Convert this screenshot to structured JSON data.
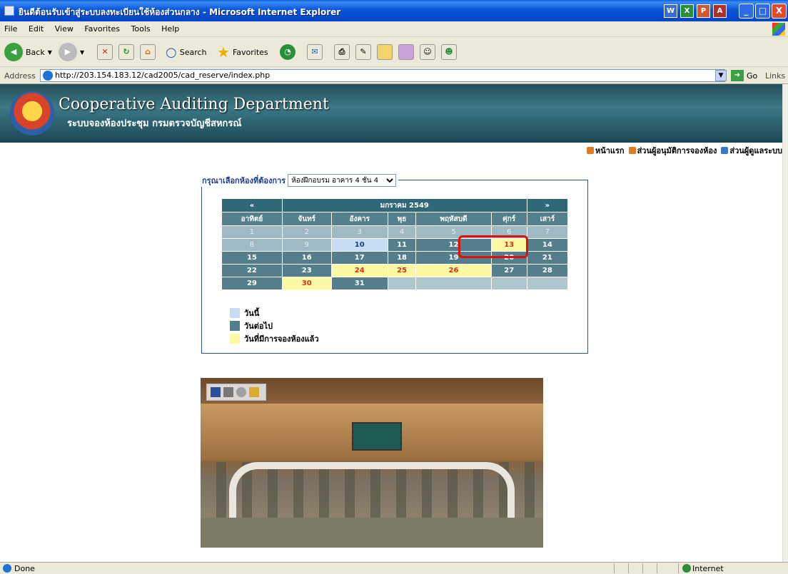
{
  "window": {
    "title": "ยินดีต้อนรับเข้าสู่ระบบลงทะเบียนใช้ห้องส่วนกลาง - Microsoft Internet Explorer",
    "taskbar_apps": [
      "W",
      "X",
      "P",
      "A"
    ],
    "controls": {
      "minimize": "_",
      "maximize": "□",
      "close": "X"
    }
  },
  "menu": [
    "File",
    "Edit",
    "View",
    "Favorites",
    "Tools",
    "Help"
  ],
  "toolbar": {
    "back": "Back",
    "search": "Search",
    "favorites": "Favorites"
  },
  "address": {
    "label": "Address",
    "url": "http://203.154.183.12/cad2005/cad_reserve/index.php",
    "go": "Go",
    "links": "Links"
  },
  "banner": {
    "title": "Cooperative Auditing Department",
    "subtitle": "ระบบจองห้องประชุม กรมตรวจบัญชีสหกรณ์"
  },
  "topnav": [
    "หน้าแรก",
    "ส่วนผู้อนุมัติการจองห้อง",
    "ส่วนผู้ดูแลระบบ"
  ],
  "room_select": {
    "label": "กรุณาเลือกห้องที่ต้องการ",
    "selected": "ห้องฝึกอบรม อาคาร 4 ชั้น 4"
  },
  "calendar": {
    "prev": "«",
    "next": "»",
    "month": "มกราคม 2549",
    "days_of_week": [
      "อาทิตย์",
      "จันทร์",
      "อังคาร",
      "พุธ",
      "พฤหัสบดี",
      "ศุกร์",
      "เสาร์"
    ],
    "weeks": [
      [
        {
          "d": "1",
          "s": "past"
        },
        {
          "d": "2",
          "s": "past"
        },
        {
          "d": "3",
          "s": "past"
        },
        {
          "d": "4",
          "s": "past"
        },
        {
          "d": "5",
          "s": "past"
        },
        {
          "d": "6",
          "s": "past"
        },
        {
          "d": "7",
          "s": "past"
        }
      ],
      [
        {
          "d": "8",
          "s": "past"
        },
        {
          "d": "9",
          "s": "past"
        },
        {
          "d": "10",
          "s": "today"
        },
        {
          "d": "11",
          "s": "next"
        },
        {
          "d": "12",
          "s": "next"
        },
        {
          "d": "13",
          "s": "booked"
        },
        {
          "d": "14",
          "s": "next"
        }
      ],
      [
        {
          "d": "15",
          "s": "next"
        },
        {
          "d": "16",
          "s": "next"
        },
        {
          "d": "17",
          "s": "next"
        },
        {
          "d": "18",
          "s": "next"
        },
        {
          "d": "19",
          "s": "next"
        },
        {
          "d": "20",
          "s": "next"
        },
        {
          "d": "21",
          "s": "next"
        }
      ],
      [
        {
          "d": "22",
          "s": "next"
        },
        {
          "d": "23",
          "s": "next"
        },
        {
          "d": "24",
          "s": "booked"
        },
        {
          "d": "25",
          "s": "booked"
        },
        {
          "d": "26",
          "s": "booked"
        },
        {
          "d": "27",
          "s": "next"
        },
        {
          "d": "28",
          "s": "next"
        }
      ],
      [
        {
          "d": "29",
          "s": "next"
        },
        {
          "d": "30",
          "s": "booked"
        },
        {
          "d": "31",
          "s": "next"
        },
        {
          "d": "",
          "s": "blank"
        },
        {
          "d": "",
          "s": "blank"
        },
        {
          "d": "",
          "s": "blank"
        },
        {
          "d": "",
          "s": "blank"
        }
      ]
    ]
  },
  "legend": [
    {
      "label": "วันนี้",
      "color": "#c6ddf3"
    },
    {
      "label": "วันต่อไป",
      "color": "#557e8c"
    },
    {
      "label": "วันที่มีการจองห้องแล้ว",
      "color": "#fdf8a2"
    }
  ],
  "status": {
    "text": "Done",
    "zone": "Internet"
  }
}
